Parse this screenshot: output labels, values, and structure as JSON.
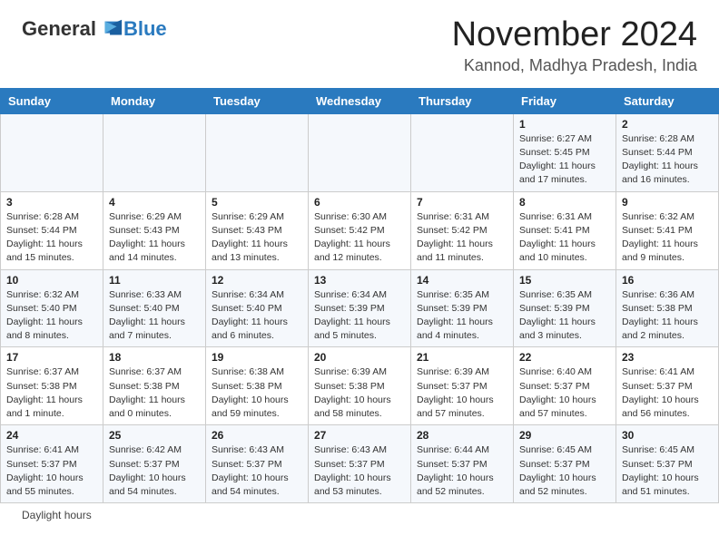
{
  "logo": {
    "general": "General",
    "blue": "Blue"
  },
  "title": "November 2024",
  "subtitle": "Kannod, Madhya Pradesh, India",
  "days_of_week": [
    "Sunday",
    "Monday",
    "Tuesday",
    "Wednesday",
    "Thursday",
    "Friday",
    "Saturday"
  ],
  "weeks": [
    [
      {
        "day": "",
        "info": ""
      },
      {
        "day": "",
        "info": ""
      },
      {
        "day": "",
        "info": ""
      },
      {
        "day": "",
        "info": ""
      },
      {
        "day": "",
        "info": ""
      },
      {
        "day": "1",
        "info": "Sunrise: 6:27 AM\nSunset: 5:45 PM\nDaylight: 11 hours and 17 minutes."
      },
      {
        "day": "2",
        "info": "Sunrise: 6:28 AM\nSunset: 5:44 PM\nDaylight: 11 hours and 16 minutes."
      }
    ],
    [
      {
        "day": "3",
        "info": "Sunrise: 6:28 AM\nSunset: 5:44 PM\nDaylight: 11 hours and 15 minutes."
      },
      {
        "day": "4",
        "info": "Sunrise: 6:29 AM\nSunset: 5:43 PM\nDaylight: 11 hours and 14 minutes."
      },
      {
        "day": "5",
        "info": "Sunrise: 6:29 AM\nSunset: 5:43 PM\nDaylight: 11 hours and 13 minutes."
      },
      {
        "day": "6",
        "info": "Sunrise: 6:30 AM\nSunset: 5:42 PM\nDaylight: 11 hours and 12 minutes."
      },
      {
        "day": "7",
        "info": "Sunrise: 6:31 AM\nSunset: 5:42 PM\nDaylight: 11 hours and 11 minutes."
      },
      {
        "day": "8",
        "info": "Sunrise: 6:31 AM\nSunset: 5:41 PM\nDaylight: 11 hours and 10 minutes."
      },
      {
        "day": "9",
        "info": "Sunrise: 6:32 AM\nSunset: 5:41 PM\nDaylight: 11 hours and 9 minutes."
      }
    ],
    [
      {
        "day": "10",
        "info": "Sunrise: 6:32 AM\nSunset: 5:40 PM\nDaylight: 11 hours and 8 minutes."
      },
      {
        "day": "11",
        "info": "Sunrise: 6:33 AM\nSunset: 5:40 PM\nDaylight: 11 hours and 7 minutes."
      },
      {
        "day": "12",
        "info": "Sunrise: 6:34 AM\nSunset: 5:40 PM\nDaylight: 11 hours and 6 minutes."
      },
      {
        "day": "13",
        "info": "Sunrise: 6:34 AM\nSunset: 5:39 PM\nDaylight: 11 hours and 5 minutes."
      },
      {
        "day": "14",
        "info": "Sunrise: 6:35 AM\nSunset: 5:39 PM\nDaylight: 11 hours and 4 minutes."
      },
      {
        "day": "15",
        "info": "Sunrise: 6:35 AM\nSunset: 5:39 PM\nDaylight: 11 hours and 3 minutes."
      },
      {
        "day": "16",
        "info": "Sunrise: 6:36 AM\nSunset: 5:38 PM\nDaylight: 11 hours and 2 minutes."
      }
    ],
    [
      {
        "day": "17",
        "info": "Sunrise: 6:37 AM\nSunset: 5:38 PM\nDaylight: 11 hours and 1 minute."
      },
      {
        "day": "18",
        "info": "Sunrise: 6:37 AM\nSunset: 5:38 PM\nDaylight: 11 hours and 0 minutes."
      },
      {
        "day": "19",
        "info": "Sunrise: 6:38 AM\nSunset: 5:38 PM\nDaylight: 10 hours and 59 minutes."
      },
      {
        "day": "20",
        "info": "Sunrise: 6:39 AM\nSunset: 5:38 PM\nDaylight: 10 hours and 58 minutes."
      },
      {
        "day": "21",
        "info": "Sunrise: 6:39 AM\nSunset: 5:37 PM\nDaylight: 10 hours and 57 minutes."
      },
      {
        "day": "22",
        "info": "Sunrise: 6:40 AM\nSunset: 5:37 PM\nDaylight: 10 hours and 57 minutes."
      },
      {
        "day": "23",
        "info": "Sunrise: 6:41 AM\nSunset: 5:37 PM\nDaylight: 10 hours and 56 minutes."
      }
    ],
    [
      {
        "day": "24",
        "info": "Sunrise: 6:41 AM\nSunset: 5:37 PM\nDaylight: 10 hours and 55 minutes."
      },
      {
        "day": "25",
        "info": "Sunrise: 6:42 AM\nSunset: 5:37 PM\nDaylight: 10 hours and 54 minutes."
      },
      {
        "day": "26",
        "info": "Sunrise: 6:43 AM\nSunset: 5:37 PM\nDaylight: 10 hours and 54 minutes."
      },
      {
        "day": "27",
        "info": "Sunrise: 6:43 AM\nSunset: 5:37 PM\nDaylight: 10 hours and 53 minutes."
      },
      {
        "day": "28",
        "info": "Sunrise: 6:44 AM\nSunset: 5:37 PM\nDaylight: 10 hours and 52 minutes."
      },
      {
        "day": "29",
        "info": "Sunrise: 6:45 AM\nSunset: 5:37 PM\nDaylight: 10 hours and 52 minutes."
      },
      {
        "day": "30",
        "info": "Sunrise: 6:45 AM\nSunset: 5:37 PM\nDaylight: 10 hours and 51 minutes."
      }
    ]
  ],
  "footer": "Daylight hours"
}
